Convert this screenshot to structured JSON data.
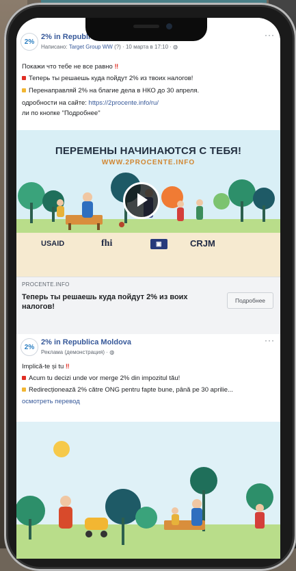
{
  "post1": {
    "page_name": "2% in Republica Moldova",
    "meta_prefix": "Написано:",
    "meta_author": "Target Group WW",
    "meta_suffix": "(?) · 10 марта в 17:10 · ",
    "lines": [
      "Покажи что тебе не все равно",
      "Теперь ты решаешь куда пойдут 2% из твоих налогов!",
      "Перенаправляй 2% на благие дела в НКО до 30 апреля.",
      "одробности на сайте: ",
      "ли по кнопке \"Подробнее\""
    ],
    "url": "https://2procente.info/ru/",
    "hero_title": "ПЕРЕМЕНЫ НАЧИНАЮТСЯ С ТЕБЯ!",
    "hero_url": "WWW.2PROCENTE.INFO",
    "logos": [
      "USAID",
      "fhi",
      "CRJM"
    ],
    "cta_domain": "PROCENTE.INFO",
    "cta_title": "Теперь ты решаешь куда пойдут 2% из воих налогов!",
    "cta_button": "Подробнее"
  },
  "post2": {
    "page_name": "2% in Republica Moldova",
    "meta": "Реклама (демонстрация) · ",
    "lines": [
      "Implică-te și tu",
      "Acum tu decizi unde vor merge 2% din impozitul tău!",
      "Redirecționează 2% către ONG pentru fapte bune, până pe 30 aprilie..."
    ],
    "translate": "осмотреть перевод"
  },
  "avatar_text": "2%",
  "more_label": "···",
  "colors": {
    "link": "#365899",
    "accent": "#d18632",
    "alert": "#e02e24"
  },
  "icons": [
    "play-icon",
    "more-options-icon",
    "globe-icon"
  ]
}
